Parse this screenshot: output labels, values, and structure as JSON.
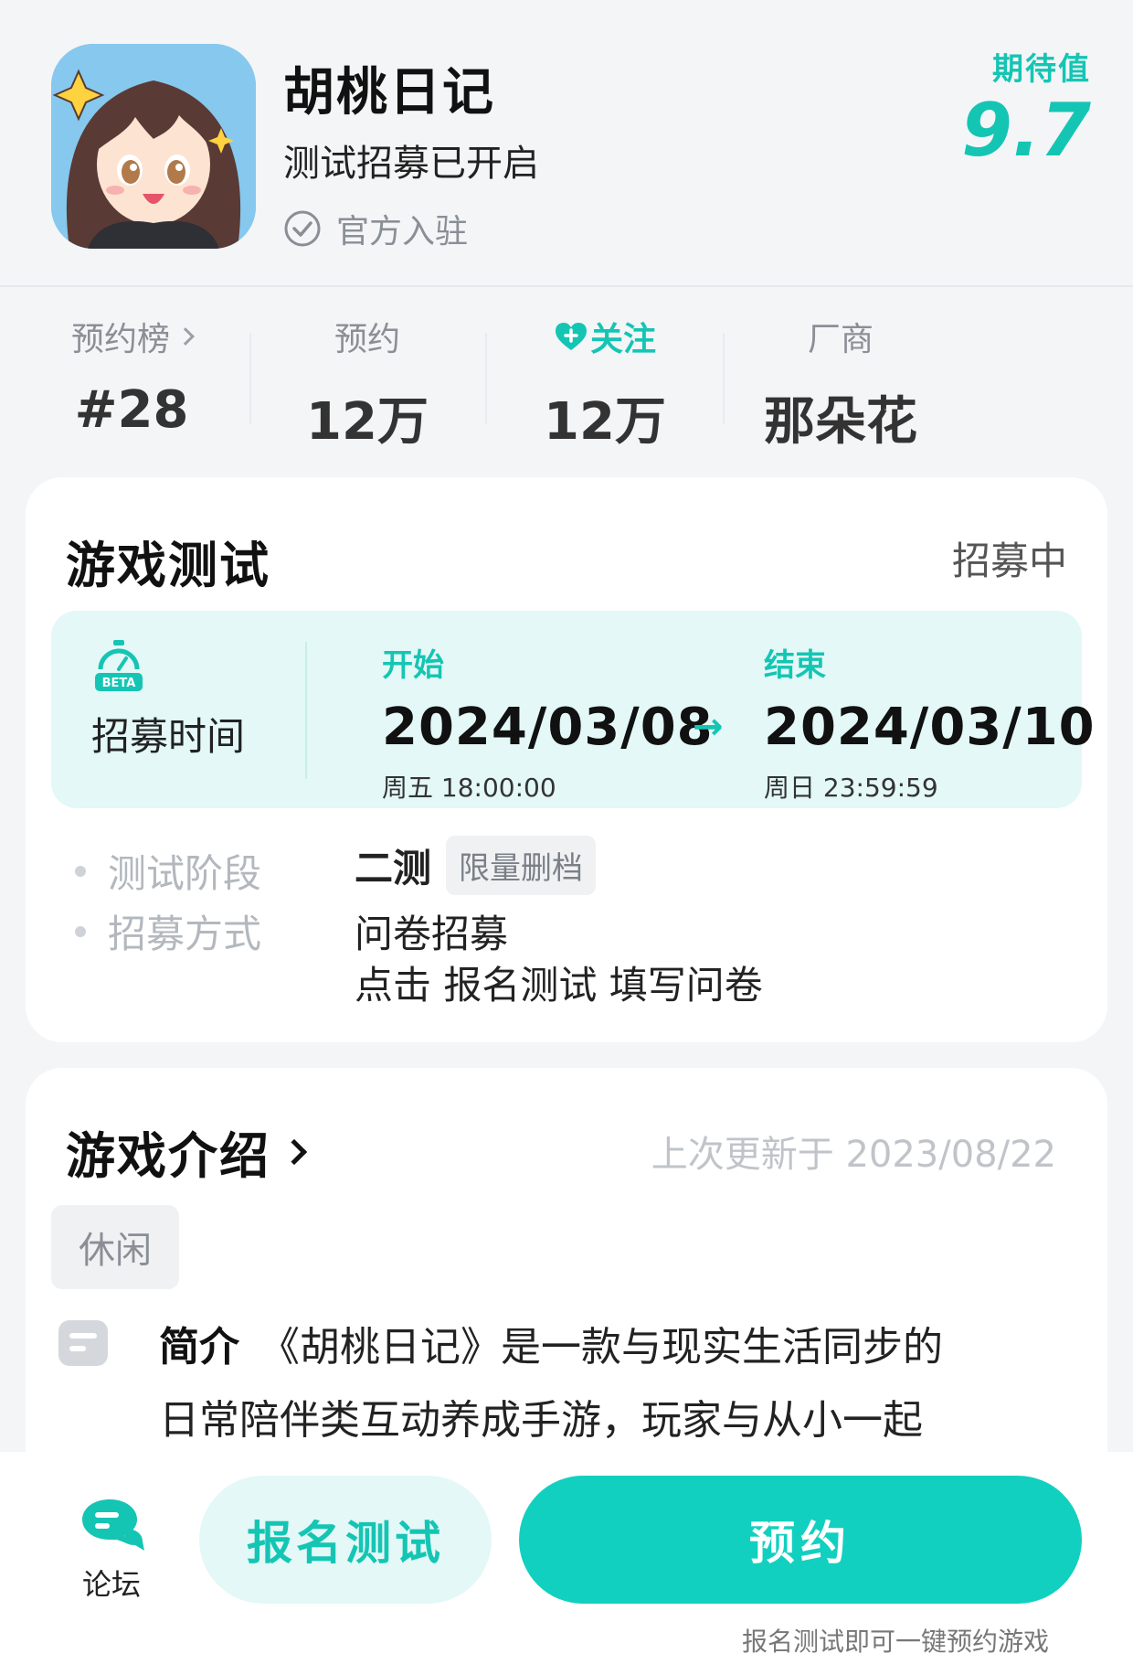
{
  "header": {
    "app_name": "胡桃日记",
    "app_status": "测试招募已开启",
    "official_label": "官方入驻",
    "expect_label": "期待值",
    "expect_score": "9.7"
  },
  "stats": {
    "rank": {
      "label": "预约榜",
      "value": "#28"
    },
    "reservations": {
      "label": "预约",
      "value": "12万"
    },
    "follow": {
      "label": "关注",
      "value": "12万"
    },
    "vendor": {
      "label": "厂商",
      "value": "那朵花"
    }
  },
  "test_card": {
    "title": "游戏测试",
    "status": "招募中",
    "time_label": "招募时间",
    "beta_text": "BETA",
    "start": {
      "head": "开始",
      "date": "2024/03/08",
      "sub": "周五  18:00:00"
    },
    "arrow": "→",
    "end": {
      "head": "结束",
      "date": "2024/03/10",
      "sub": "周日  23:59:59"
    },
    "phase_label": "测试阶段",
    "phase_value": "二测",
    "phase_tag": "限量删档",
    "method_label": "招募方式",
    "method_value": "问卷招募",
    "method_detail": "点击 报名测试 填写问卷"
  },
  "intro_card": {
    "title": "游戏介绍",
    "updated": "上次更新于 2023/08/22",
    "genre": "休闲",
    "summary_label": "简介",
    "summary_line1": "《胡桃日记》是一款与现实生活同步的",
    "summary_line2": "日常陪伴类互动养成手游，玩家与从小一起"
  },
  "bottom_bar": {
    "forum_label": "论坛",
    "signup_label": "报名测试",
    "reserve_label": "预约",
    "hint": "报名测试即可一键预约游戏"
  },
  "colors": {
    "accent": "#15c5b3",
    "accent_light": "#e3f8f7",
    "button": "#12d0bf"
  }
}
